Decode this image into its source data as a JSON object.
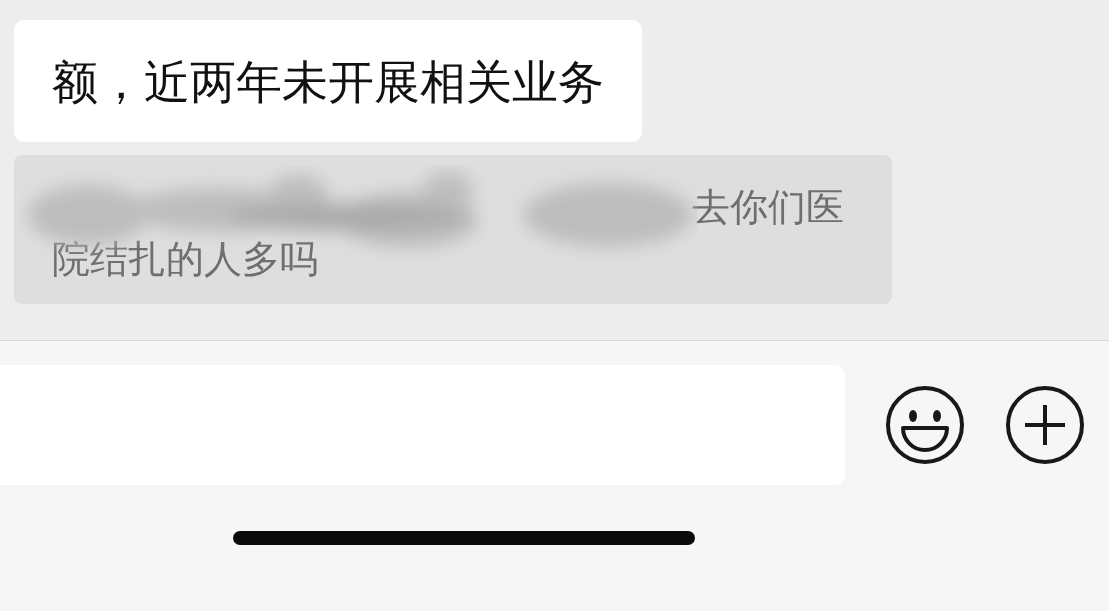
{
  "messages": [
    {
      "kind": "bubble",
      "text": "额，近两年未开展相关业务"
    },
    {
      "kind": "quote",
      "text": "去你们医院结扎的人多吗",
      "redacted": true
    }
  ],
  "composer": {
    "buttons": [
      {
        "kind": "emoji"
      },
      {
        "kind": "plus"
      }
    ]
  }
}
